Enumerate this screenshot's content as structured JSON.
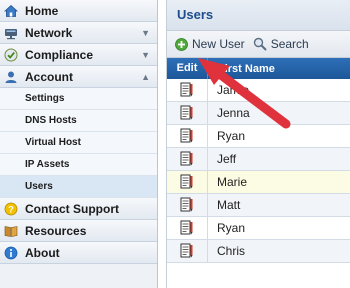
{
  "sidebar": {
    "home": "Home",
    "network": "Network",
    "compliance": "Compliance",
    "account": "Account",
    "account_items": [
      "Settings",
      "DNS Hosts",
      "Virtual Host",
      "IP Assets",
      "Users"
    ],
    "contact_support": "Contact Support",
    "resources": "Resources",
    "about": "About"
  },
  "main": {
    "title": "Users",
    "toolbar": {
      "new_user": "New User",
      "search": "Search"
    },
    "table": {
      "col_edit": "Edit",
      "col_name": "First Name",
      "rows": [
        "Jamie",
        "Jenna",
        "Ryan",
        "Jeff",
        "Marie",
        "Matt",
        "Ryan",
        "Chris"
      ]
    }
  },
  "colors": {
    "header_blue": "#1d5799",
    "title_blue": "#1e4e8c",
    "arrow_red": "#e0323c"
  }
}
